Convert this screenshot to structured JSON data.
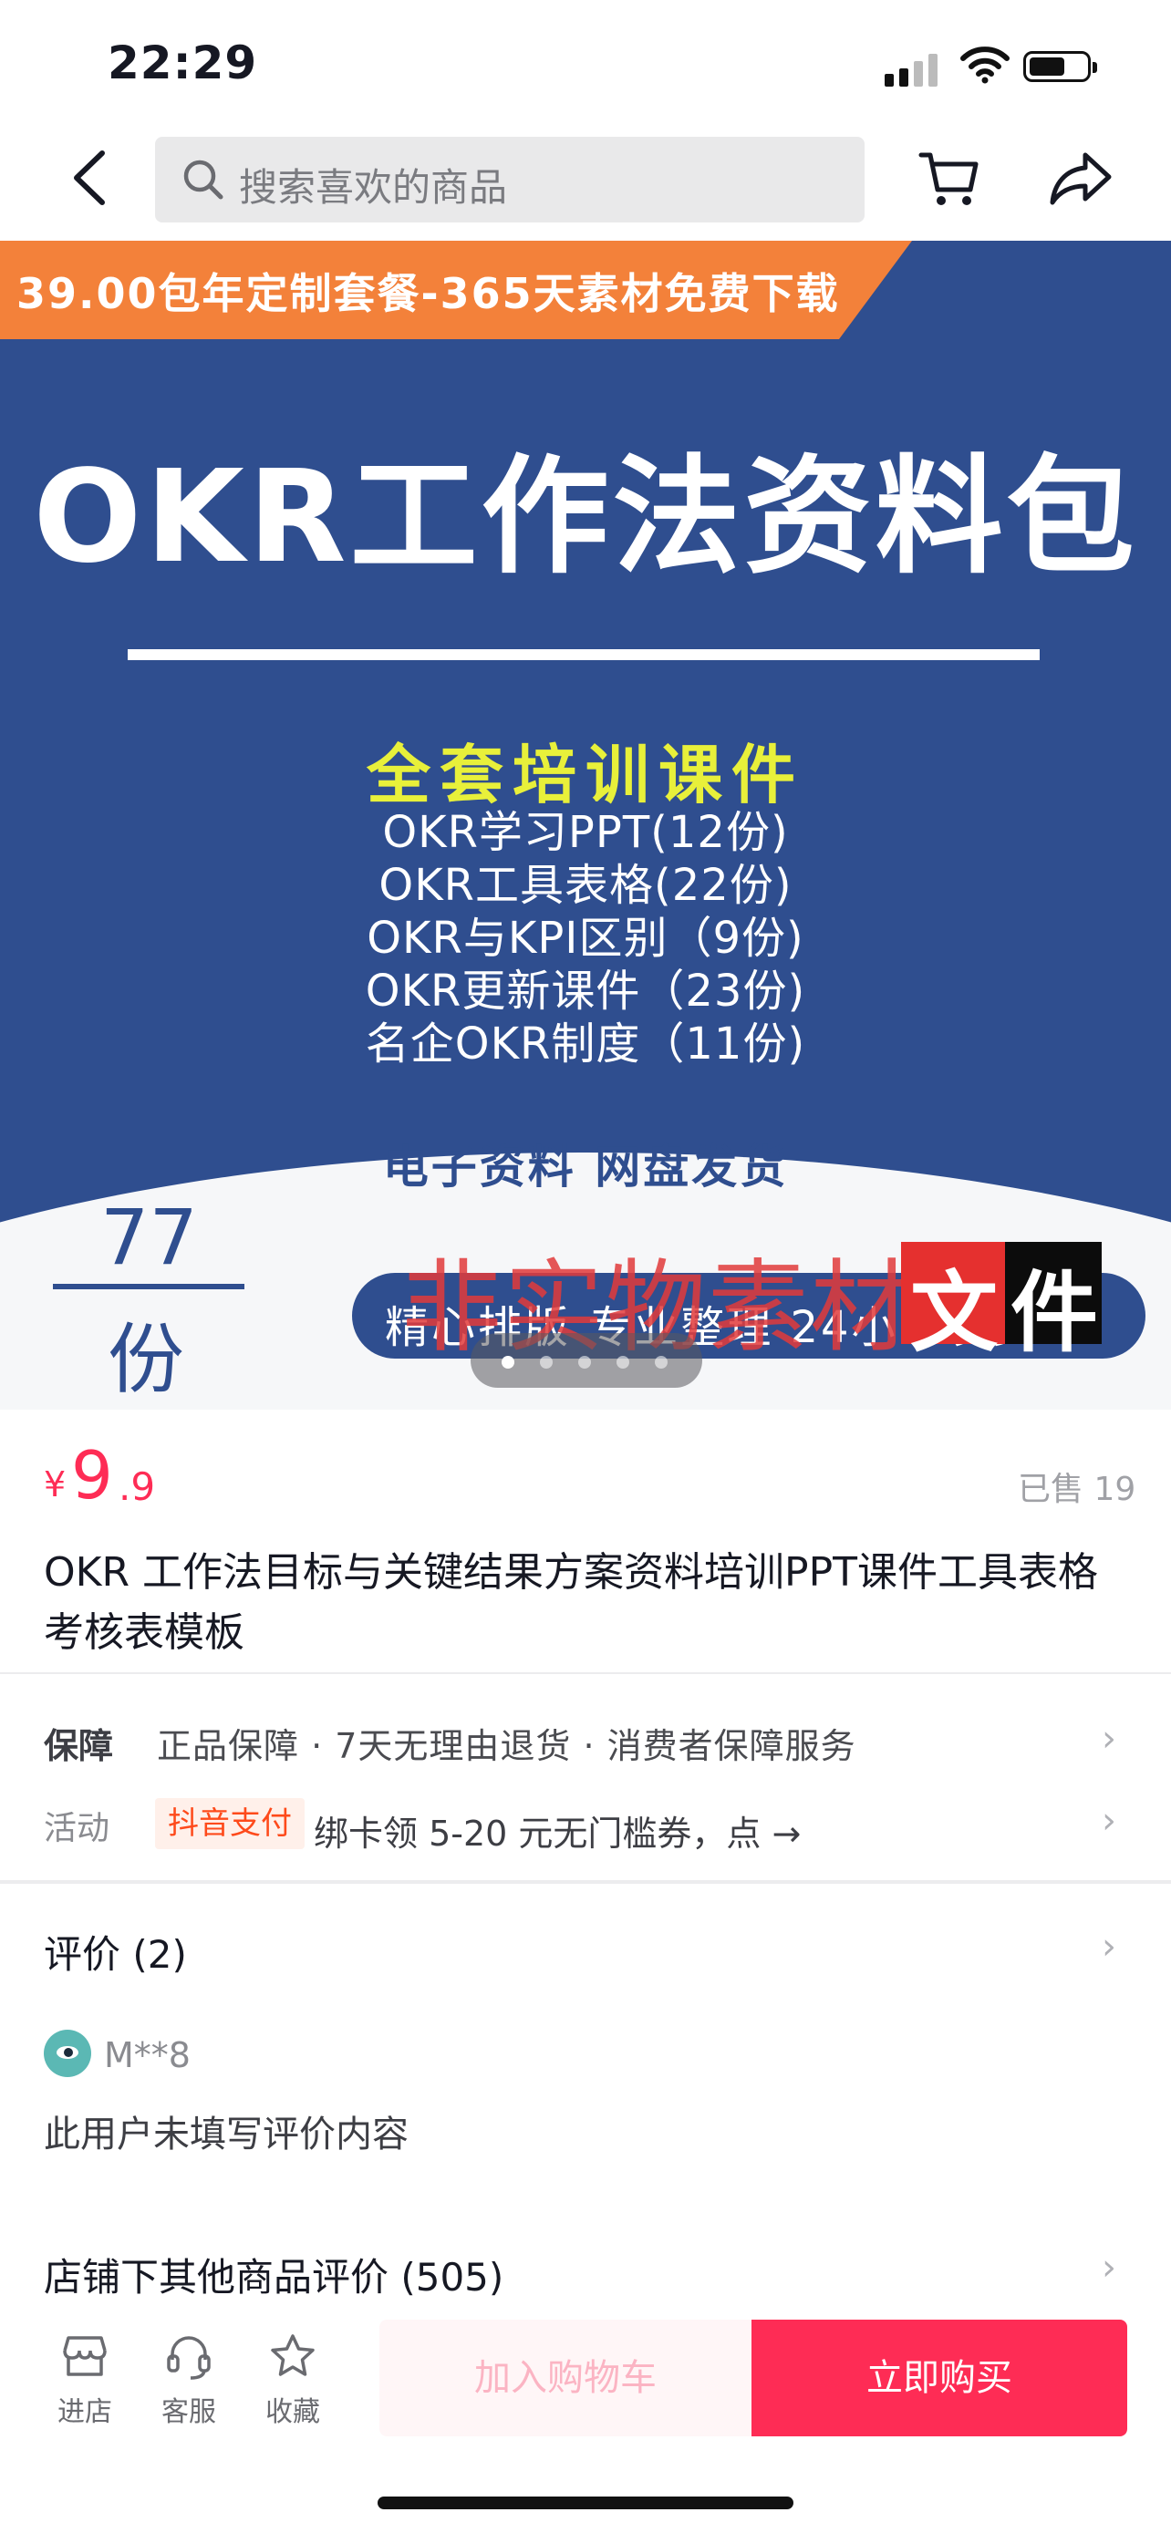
{
  "status_bar": {
    "time": "22:29"
  },
  "nav": {
    "search_placeholder": "搜索喜欢的商品"
  },
  "banner": {
    "promo": "39.00包年定制套餐-365天素材免费下载",
    "title": "OKR工作法资料包",
    "subtitle": "全套培训课件",
    "lines": [
      "OKR学习PPT(12份)",
      "OKR工具表格(22份)",
      "OKR与KPI区别（9份)",
      "OKR更新课件（23份)",
      "名企OKR制度（11份)"
    ],
    "delivery": "电子资料 网盘发货",
    "count_number": "77",
    "count_unit": "份",
    "slogan": "精心排版 专业整理 24小时发货",
    "watermark": "非实物素材",
    "watermark_box1": "文",
    "watermark_box2": "件",
    "page_dots": 5,
    "active_dot": 1
  },
  "product": {
    "currency": "¥",
    "price_int": "9",
    "price_dec": ".9",
    "sold": "已售 19",
    "title": "OKR 工作法目标与关键结果方案资料培训PPT课件工具表格考核表模板"
  },
  "guarantee": {
    "label": "保障",
    "text": "正品保障 · 7天无理由退货 · 消费者保障服务"
  },
  "activity": {
    "label": "活动",
    "tag": "抖音支付",
    "text": "绑卡领 5-20 元无门槛券，点 →"
  },
  "reviews": {
    "title": "评价 (2)",
    "reviewer": "M**8",
    "text": "此用户未填写评价内容",
    "other_title": "店铺下其他商品评价 (505)"
  },
  "bottom_bar": {
    "shop": "进店",
    "service": "客服",
    "favorite": "收藏",
    "add_to_cart": "加入购物车",
    "buy_now": "立即购买"
  },
  "colors": {
    "accent": "#fe2c55",
    "banner_blue": "#2f4e8f",
    "promo_orange": "#f3813a",
    "subtitle_yellow": "#e8f03a"
  }
}
